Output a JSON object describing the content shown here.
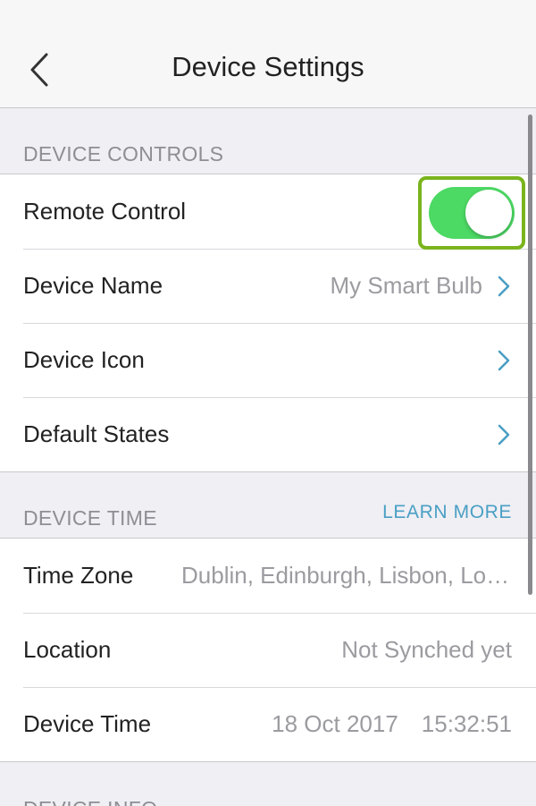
{
  "header": {
    "title": "Device Settings",
    "back_icon": "chevron-left-icon"
  },
  "sections": {
    "controls": {
      "title": "DEVICE CONTROLS",
      "remote_control": {
        "label": "Remote Control",
        "toggle_on": true,
        "toggle_color": "#4cd964",
        "highlight_color": "#7ab41d"
      },
      "device_name": {
        "label": "Device Name",
        "value": "My Smart Bulb"
      },
      "device_icon": {
        "label": "Device Icon"
      },
      "default_states": {
        "label": "Default States"
      }
    },
    "time": {
      "title": "DEVICE TIME",
      "link": "LEARN MORE",
      "time_zone": {
        "label": "Time Zone",
        "value": "Dublin, Edinburgh, Lisbon, London"
      },
      "location": {
        "label": "Location",
        "value": "Not Synched yet"
      },
      "device_time": {
        "label": "Device Time",
        "date": "18 Oct 2017",
        "time": "15:32:51"
      }
    },
    "info": {
      "title": "DEVICE INFO"
    }
  },
  "colors": {
    "accent": "#4a9fc4",
    "secondary_text": "#9b9ba0",
    "background": "#efeff4"
  }
}
